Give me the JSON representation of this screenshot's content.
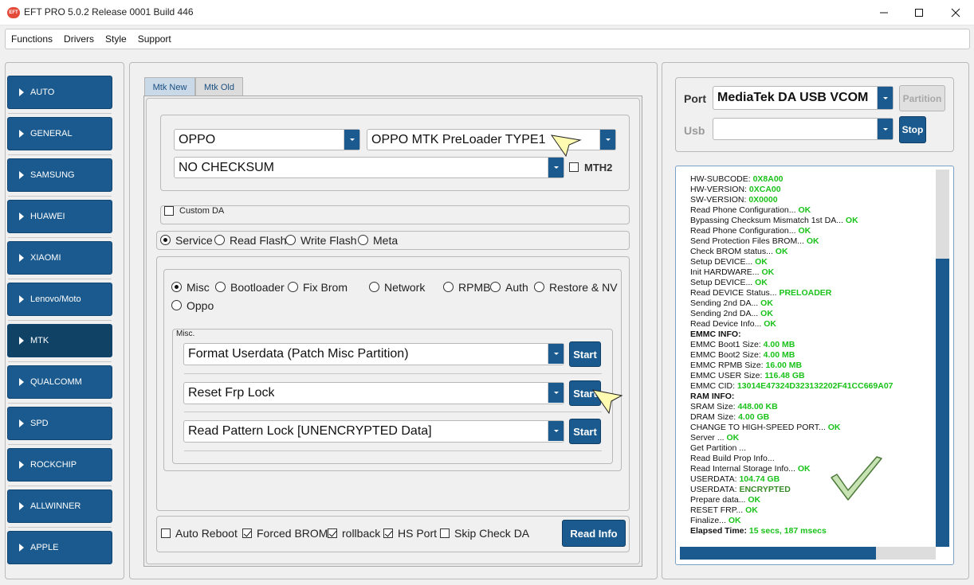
{
  "window": {
    "title": "EFT PRO 5.0.2 Release 0001 Build 446",
    "app_icon_text": "EFT"
  },
  "menu": [
    "Functions",
    "Drivers",
    "Style",
    "Support"
  ],
  "sidebar": {
    "items": [
      {
        "label": "AUTO"
      },
      {
        "label": "GENERAL"
      },
      {
        "label": "SAMSUNG"
      },
      {
        "label": "HUAWEI"
      },
      {
        "label": "XIAOMI"
      },
      {
        "label": "Lenovo/Moto"
      },
      {
        "label": "MTK",
        "active": true
      },
      {
        "label": "QUALCOMM"
      },
      {
        "label": "SPD"
      },
      {
        "label": "ROCKCHIP"
      },
      {
        "label": "ALLWINNER"
      },
      {
        "label": "APPLE"
      }
    ]
  },
  "tabs": [
    "Mtk New",
    "Mtk Old"
  ],
  "device": {
    "brand": "OPPO",
    "preloader": "OPPO MTK PreLoader TYPE1",
    "checksum": "NO CHECKSUM",
    "mth2_label": "MTH2"
  },
  "custom_da_label": "Custom DA",
  "modes": [
    {
      "label": "Service",
      "checked": true
    },
    {
      "label": "Read Flash",
      "checked": false
    },
    {
      "label": "Write Flash",
      "checked": false
    },
    {
      "label": "Meta",
      "checked": false
    }
  ],
  "sub_modes": [
    {
      "label": "Misc",
      "checked": true
    },
    {
      "label": "Bootloader",
      "checked": false
    },
    {
      "label": "Fix Brom",
      "checked": false
    },
    {
      "label": "Network",
      "checked": false
    },
    {
      "label": "RPMB",
      "checked": false
    },
    {
      "label": "Auth",
      "checked": false
    },
    {
      "label": "Restore & NV",
      "checked": false
    },
    {
      "label": "Oppo",
      "checked": false
    }
  ],
  "misc": {
    "group_label": "Misc.",
    "rows": [
      {
        "value": "Format Userdata (Patch Misc Partition)",
        "button": "Start"
      },
      {
        "value": "Reset Frp Lock",
        "button": "Start"
      },
      {
        "value": "Read Pattern Lock [UNENCRYPTED Data]",
        "button": "Start"
      }
    ]
  },
  "options": [
    {
      "label": "Auto Reboot",
      "checked": false
    },
    {
      "label": "Forced BROM",
      "checked": true
    },
    {
      "label": "rollback",
      "checked": true
    },
    {
      "label": "HS Port",
      "checked": true
    },
    {
      "label": "Skip Check DA",
      "checked": false
    }
  ],
  "read_info_label": "Read Info",
  "port": {
    "port_label": "Port",
    "port_value": "MediaTek DA USB VCOM",
    "partition_label": "Partition",
    "usb_label": "Usb",
    "usb_value": "",
    "stop_label": "Stop"
  },
  "log": [
    {
      "k": "HW-SUBCODE: ",
      "v": "0X8A00"
    },
    {
      "k": "HW-VERSION: ",
      "v": "0XCA00"
    },
    {
      "k": "SW-VERSION: ",
      "v": "0X0000"
    },
    {
      "k": "Read Phone Configuration... ",
      "v": "OK"
    },
    {
      "k": "Bypassing Checksum Mismatch 1st DA... ",
      "v": "OK"
    },
    {
      "k": "Read Phone Configuration... ",
      "v": "OK"
    },
    {
      "k": "Send Protection Files BROM... ",
      "v": "OK"
    },
    {
      "k": "Check BROM status... ",
      "v": "OK"
    },
    {
      "k": "Setup DEVICE... ",
      "v": "OK"
    },
    {
      "k": "Init HARDWARE... ",
      "v": "OK"
    },
    {
      "k": "Setup DEVICE... ",
      "v": "OK"
    },
    {
      "k": "Read DEVICE Status... ",
      "v": "PRELOADER"
    },
    {
      "k": "Sending 2nd DA... ",
      "v": "OK"
    },
    {
      "k": "Sending 2nd DA... ",
      "v": "OK"
    },
    {
      "k": "Read Device Info... ",
      "v": "OK"
    },
    {
      "k": "EMMC INFO:",
      "v": "",
      "hdr": true
    },
    {
      "k": "EMMC Boot1 Size: ",
      "v": "4.00 MB"
    },
    {
      "k": "EMMC Boot2 Size: ",
      "v": "4.00 MB"
    },
    {
      "k": "EMMC RPMB Size: ",
      "v": "16.00 MB"
    },
    {
      "k": "EMMC USER Size: ",
      "v": "116.48 GB"
    },
    {
      "k": "EMMC CID: ",
      "v": "13014E47324D323132202F41CC669A07"
    },
    {
      "k": "RAM INFO:",
      "v": "",
      "hdr": true
    },
    {
      "k": "SRAM Size: ",
      "v": "448.00 KB"
    },
    {
      "k": "DRAM Size: ",
      "v": "4.00 GB"
    },
    {
      "k": "CHANGE TO HIGH-SPEED PORT... ",
      "v": "OK"
    },
    {
      "k": "Server ... ",
      "v": "OK"
    },
    {
      "k": "Get Partition ...",
      "v": ""
    },
    {
      "k": "Read Build Prop Info...",
      "v": ""
    },
    {
      "k": "Read Internal Storage Info... ",
      "v": "OK"
    },
    {
      "k": "USERDATA: ",
      "v": "104.74 GB"
    },
    {
      "k": "USERDATA: ",
      "v": "ENCRYPTED",
      "warn": true
    },
    {
      "k": "Prepare data... ",
      "v": "OK"
    },
    {
      "k": "RESET FRP... ",
      "v": "OK"
    },
    {
      "k": "Finalize... ",
      "v": "OK"
    },
    {
      "k": "Elapsed Time: ",
      "v": "15 secs, 187 msecs",
      "hdr": true
    }
  ],
  "colors": {
    "accent": "#1a5a8e",
    "ok": "#19c219",
    "encrypted": "#3a8c2a"
  }
}
